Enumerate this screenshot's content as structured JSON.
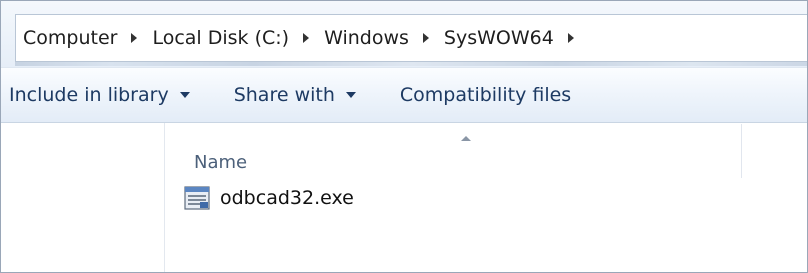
{
  "address_bar": {
    "crumbs": [
      "Computer",
      "Local Disk (C:)",
      "Windows",
      "SysWOW64"
    ]
  },
  "toolbar": {
    "include_in_library": "Include in library",
    "share_with": "Share with",
    "compatibility_files": "Compatibility files"
  },
  "file_list": {
    "columns": [
      "Name"
    ],
    "sorted_column": "Name",
    "rows": [
      {
        "name": "odbcad32.exe",
        "icon": "application-icon"
      }
    ]
  }
}
